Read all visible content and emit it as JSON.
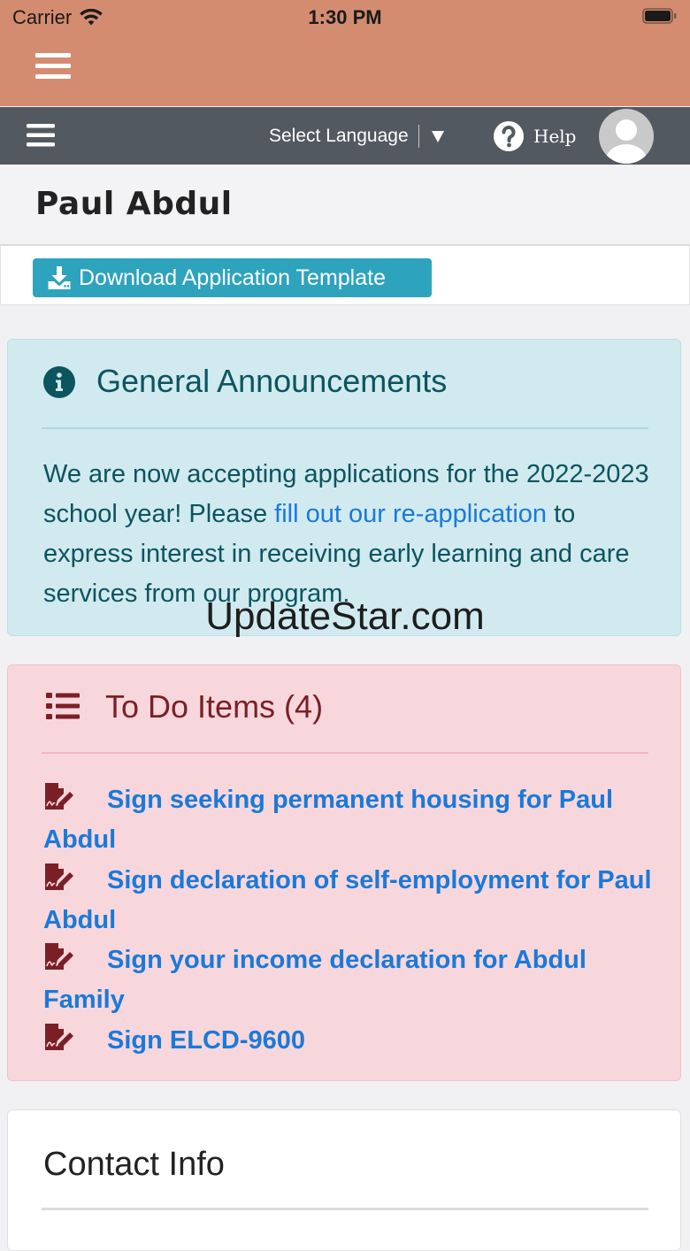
{
  "status_bar": {
    "carrier": "Carrier",
    "time": "1:30 PM",
    "icons": [
      "wifi-icon",
      "battery-icon"
    ]
  },
  "navbar": {
    "language_label": "Select Language",
    "help_label": "Help",
    "icons": [
      "hamburger-menu-icon",
      "caret-down-icon",
      "question-circle-icon",
      "user-avatar-icon"
    ]
  },
  "header": {
    "name": "Paul Abdul",
    "download_button_label": "Download Application Template",
    "download_icon": "download-icon"
  },
  "announcements": {
    "title": "General Announcements",
    "icon": "info-circle-icon",
    "text_before": "We are now accepting applications for the 2022-2023 school year! Please ",
    "link_text": "fill out our re-application",
    "text_after": " to express interest in receiving early learning and care services from our program."
  },
  "watermark": "UpdateStar.com",
  "todo": {
    "title": "To Do Items (4)",
    "icon": "list-icon",
    "items": [
      {
        "label": "Sign seeking permanent housing for Paul Abdul",
        "icon": "signature-icon"
      },
      {
        "label": "Sign declaration of self-employment for Paul Abdul",
        "icon": "signature-icon"
      },
      {
        "label": "Sign your income declaration for Abdul Family",
        "icon": "signature-icon"
      },
      {
        "label": "Sign ELCD-9600",
        "icon": "signature-icon"
      }
    ]
  },
  "contact": {
    "title": "Contact Info"
  },
  "colors": {
    "status_bar_bg": "#d48c70",
    "navbar_bg": "#535960",
    "download_button_bg": "#2ea3bd",
    "announce_bg": "#d1eaef",
    "announce_text": "#0c5460",
    "todo_bg": "#f8d7dc",
    "todo_text": "#7b1f27",
    "link": "#1a7ad8"
  }
}
